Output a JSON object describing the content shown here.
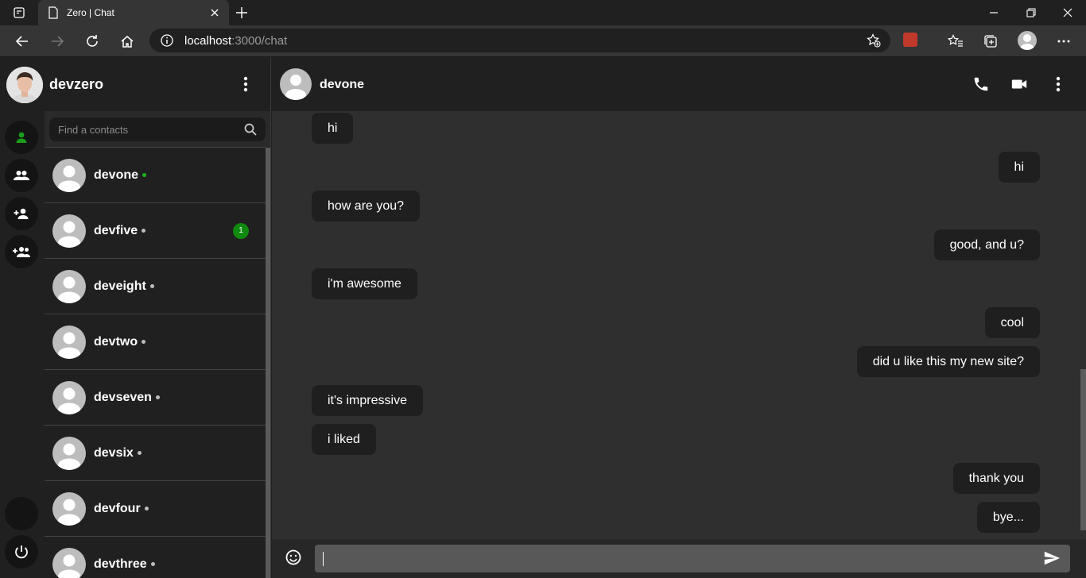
{
  "browser": {
    "tab_title": "Zero | Chat",
    "url_host": "localhost",
    "url_rest": ":3000/chat"
  },
  "user": {
    "name": "devzero"
  },
  "search": {
    "placeholder": "Find a contacts"
  },
  "contacts": [
    {
      "name": "devone",
      "online": true,
      "unread": ""
    },
    {
      "name": "devfive",
      "online": false,
      "unread": "1"
    },
    {
      "name": "deveight",
      "online": false,
      "unread": ""
    },
    {
      "name": "devtwo",
      "online": false,
      "unread": ""
    },
    {
      "name": "devseven",
      "online": false,
      "unread": ""
    },
    {
      "name": "devsix",
      "online": false,
      "unread": ""
    },
    {
      "name": "devfour",
      "online": false,
      "unread": ""
    },
    {
      "name": "devthree",
      "online": false,
      "unread": ""
    }
  ],
  "chat": {
    "peer_name": "devone",
    "messages": [
      {
        "text": "hi",
        "dir": "in"
      },
      {
        "text": "hi",
        "dir": "out"
      },
      {
        "text": "how are you?",
        "dir": "in"
      },
      {
        "text": "good, and u?",
        "dir": "out"
      },
      {
        "text": "i'm awesome",
        "dir": "in"
      },
      {
        "text": "cool",
        "dir": "out"
      },
      {
        "text": "did u like this my new site?",
        "dir": "out"
      },
      {
        "text": "it's impressive",
        "dir": "in"
      },
      {
        "text": "i liked",
        "dir": "in"
      },
      {
        "text": "thank you",
        "dir": "out"
      },
      {
        "text": "bye...",
        "dir": "out"
      }
    ]
  },
  "colors": {
    "online": "#1db21d",
    "badge": "#0f8a0f",
    "active_nav": "#1a9e1a"
  }
}
